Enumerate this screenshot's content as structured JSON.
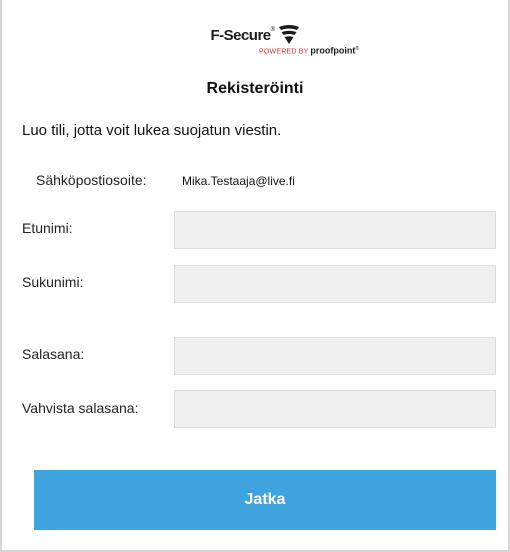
{
  "brand": {
    "name": "F-Secure",
    "trademark": "®",
    "powered_by": "POWERED BY",
    "partner": "proofpoint",
    "partner_mark": "®"
  },
  "form": {
    "title": "Rekisteröinti",
    "intro": "Luo tili, jotta voit lukea suojatun viestin.",
    "email_label": "Sähköpostiosoite:",
    "email_value": "Mika.Testaaja@live.fi",
    "fields": {
      "firstname": {
        "label": "Etunimi:",
        "value": ""
      },
      "lastname": {
        "label": "Sukunimi:",
        "value": ""
      },
      "password": {
        "label": "Salasana:",
        "value": ""
      },
      "confirm": {
        "label": "Vahvista salasana:",
        "value": ""
      }
    },
    "submit_label": "Jatka"
  },
  "colors": {
    "button": "#3ea3df",
    "input_bg": "#efefef",
    "border": "#d6d6d6"
  }
}
